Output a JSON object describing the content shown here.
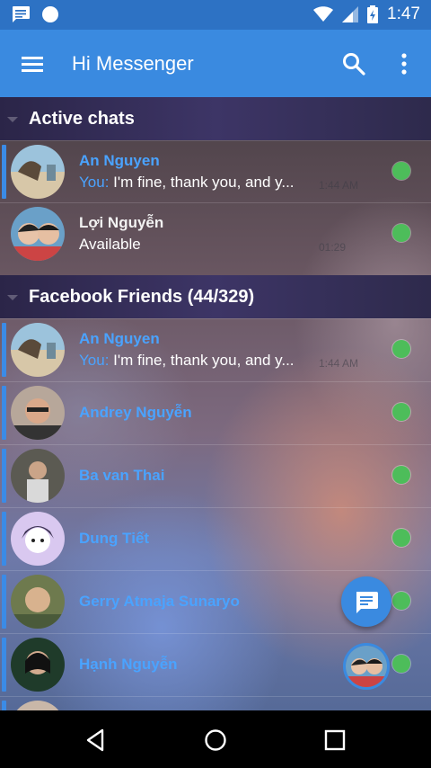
{
  "status_bar": {
    "time": "1:47"
  },
  "app_bar": {
    "title": "Hi Messenger"
  },
  "sections": {
    "active": "Active chats",
    "friends": "Facebook Friends (44/329)"
  },
  "active_chats": [
    {
      "name": "An Nguyen",
      "you": "You:",
      "message": "I'm fine, thank you, and y...",
      "time": "1:44 AM"
    },
    {
      "name": "Lợi Nguyễn",
      "status": "Available",
      "time": "01:29"
    }
  ],
  "friends": [
    {
      "name": "An Nguyen",
      "you": "You:",
      "message": "I'm fine, thank you, and y...",
      "time": "1:44 AM"
    },
    {
      "name": "Andrey Nguyễn"
    },
    {
      "name": "Ba van Thai"
    },
    {
      "name": "Dung Tiết"
    },
    {
      "name": "Gerry Atmaja Sunaryo"
    },
    {
      "name": "Hạnh Nguyễn"
    }
  ],
  "colors": {
    "primary": "#3a8ae0",
    "status_bar": "#2d72c4",
    "online": "#4dbd5a",
    "name_blue": "#4aa3ff"
  }
}
